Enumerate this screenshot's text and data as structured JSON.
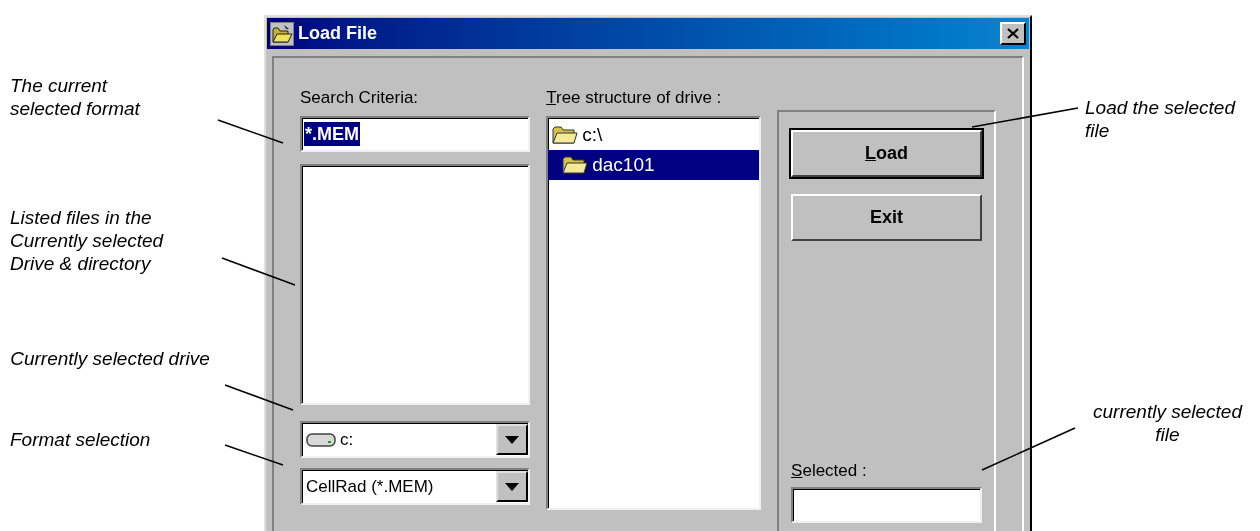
{
  "window": {
    "title": "Load File"
  },
  "search_criteria": {
    "label": "Search Criteria:",
    "value": "*.MEM",
    "value_selected": true
  },
  "drive": {
    "value": "c:"
  },
  "format": {
    "value": "CellRad (*.MEM)"
  },
  "tree": {
    "label": "Tree structure of drive :",
    "label_underline_first": true,
    "items": [
      {
        "label": "c:\\",
        "selected": false,
        "children": [
          {
            "label": "dac101",
            "selected": true
          }
        ]
      }
    ]
  },
  "buttons": [
    {
      "label": "Load",
      "default": true,
      "underline_first": true
    },
    {
      "label": "Exit",
      "default": false,
      "underline_first": false
    }
  ],
  "selected_file": {
    "label": "Selected :",
    "label_underline_first": true
  },
  "annotations": [
    {
      "text": "The current selected format"
    },
    {
      "text": "Listed files in the Currently selected Drive & directory"
    },
    {
      "text": "Currently selected drive"
    },
    {
      "text": "Format selection"
    },
    {
      "text": "Load the selected file"
    },
    {
      "text": "currently selected file"
    }
  ]
}
